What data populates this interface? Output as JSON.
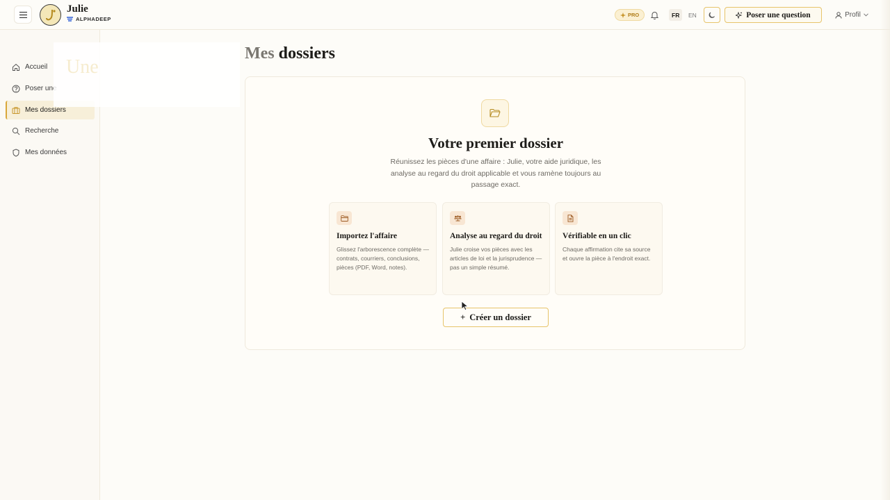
{
  "header": {
    "brand_name": "Julie",
    "brand_sub": "ALPHADEEP",
    "pro_badge": "PRO",
    "lang_fr": "FR",
    "lang_en": "EN",
    "ask_button": "Poser une question",
    "profile_button": "Profil"
  },
  "sidebar": {
    "items": [
      {
        "label": "Accueil",
        "icon": "home-icon"
      },
      {
        "label": "Poser une",
        "icon": "help-circle-icon"
      },
      {
        "label": "Mes dossiers",
        "icon": "briefcase-icon",
        "active": true
      },
      {
        "label": "Recherche",
        "icon": "search-icon"
      },
      {
        "label": "Mes données",
        "icon": "shield-icon"
      }
    ],
    "ghost_text": "Une"
  },
  "main": {
    "title_muted": "Mes",
    "title_bold": "dossiers",
    "card": {
      "title": "Votre premier dossier",
      "description": "Réunissez les pièces d'une affaire : Julie, votre aide juridique, les analyse au regard du droit applicable et vous ramène toujours au passage exact.",
      "features": [
        {
          "title": "Importez l'affaire",
          "text": "Glissez l'arborescence complète — contrats, courriers, conclusions, pièces (PDF, Word, notes).",
          "icon": "folder-icon"
        },
        {
          "title": "Analyse au regard du droit",
          "text": "Julie croise vos pièces avec les articles de loi et la jurisprudence — pas un simple résumé.",
          "icon": "scale-icon"
        },
        {
          "title": "Vérifiable en un clic",
          "text": "Chaque affirmation cite sa source et ouvre la pièce à l'endroit exact.",
          "icon": "document-icon"
        }
      ],
      "create_button": "Créer un dossier",
      "create_plus": "+"
    }
  },
  "colors": {
    "accent": "#d9a739",
    "background": "#fdfcf8",
    "border": "#efe9dc"
  }
}
